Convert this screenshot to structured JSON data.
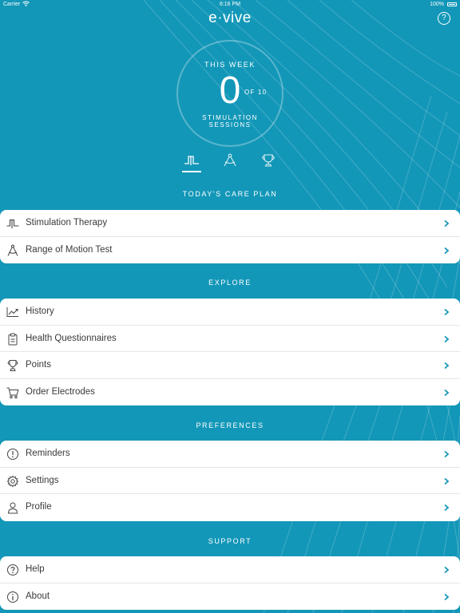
{
  "status_bar": {
    "carrier": "Carrier",
    "time": "6:16 PM",
    "battery": "100%"
  },
  "header": {
    "logo": "e·vive",
    "help_icon": "question-circle-icon",
    "help_glyph": "?"
  },
  "week": {
    "label": "THIS WEEK",
    "count": "0",
    "of_label": "OF 10",
    "sub_line1": "STIMULATION",
    "sub_line2": "SESSIONS"
  },
  "mode_tabs": [
    {
      "icon": "stimulation-pulse-icon",
      "selected": true
    },
    {
      "icon": "compass-icon",
      "selected": false
    },
    {
      "icon": "trophy-icon",
      "selected": false
    }
  ],
  "sections": {
    "care_plan": {
      "title": "TODAY'S CARE PLAN",
      "items": [
        {
          "label": "Stimulation Therapy",
          "icon": "stimulation-pulse-icon"
        },
        {
          "label": "Range of Motion Test",
          "icon": "compass-icon"
        }
      ]
    },
    "explore": {
      "title": "EXPLORE",
      "items": [
        {
          "label": "History",
          "icon": "trend-chart-icon"
        },
        {
          "label": "Health Questionnaires",
          "icon": "clipboard-icon"
        },
        {
          "label": "Points",
          "icon": "trophy-icon"
        },
        {
          "label": "Order Electrodes",
          "icon": "cart-icon"
        }
      ]
    },
    "preferences": {
      "title": "PREFERENCES",
      "items": [
        {
          "label": "Reminders",
          "icon": "alert-circle-icon"
        },
        {
          "label": "Settings",
          "icon": "gear-icon"
        },
        {
          "label": "Profile",
          "icon": "person-icon"
        }
      ]
    },
    "support": {
      "title": "SUPPORT",
      "items": [
        {
          "label": "Help",
          "icon": "question-circle-icon"
        },
        {
          "label": "About",
          "icon": "info-circle-icon"
        }
      ]
    }
  },
  "colors": {
    "background": "#1397b8",
    "chevron": "#1397b8",
    "row_text": "#3a3a3a",
    "icon": "#444444",
    "card": "#ffffff"
  }
}
